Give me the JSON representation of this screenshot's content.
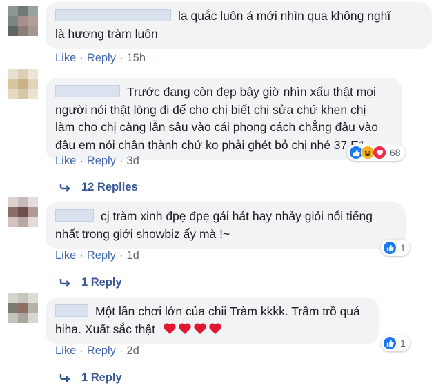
{
  "colors": {
    "bubble": "#f2f3f5",
    "link": "#4267b2",
    "like_blue": "#1877f2",
    "heart_red": "#f0284a",
    "haha_yellow": "#f7b125"
  },
  "comments": [
    {
      "text": "lạ quắc luôn á mới nhìn qua không nghĩ là hương tràm luôn",
      "line1": "lạ quắc luôn á mới nhìn qua không nghĩ",
      "line2": "là hương tràm luôn",
      "like": "Like",
      "reply": "Reply",
      "time": "15h"
    },
    {
      "line1": "Trước đang còn đẹp bây giờ nhìn xấu thật mọi",
      "line2": "người nói thật lòng đi để cho chị biết chị sửa chứ khen chị",
      "line3": "làm cho chị càng lẫn sâu vào cái phong cách chẳng đâu vào",
      "line4": "đâu em nói chân thành chứ ko phải ghét bỏ chị nhé 37 E1",
      "like": "Like",
      "reply": "Reply",
      "time": "3d",
      "reaction_icons": [
        "like-icon",
        "haha-icon",
        "love-icon"
      ],
      "reaction_count": "68",
      "replies_label": "12 Replies"
    },
    {
      "line1": "cj tràm xinh đpẹ đpẹ gái hát hay nhảy giỏi nổi tiếng",
      "line2": "nhất trong giới showbiz ấy mà !~",
      "like": "Like",
      "reply": "Reply",
      "time": "1d",
      "reaction_icons": [
        "like-icon"
      ],
      "reaction_count": "1",
      "replies_label": "1 Reply"
    },
    {
      "line1": "Một lần chơi lớn của chii Tràm kkkk. Trầm trồ quá",
      "line2": "hiha. Xuất sắc thật",
      "emoji": [
        "heart-emoji",
        "heart-emoji",
        "heart-emoji",
        "heart-emoji"
      ],
      "like": "Like",
      "reply": "Reply",
      "time": "2d",
      "reaction_icons": [
        "like-icon"
      ],
      "reaction_count": "1",
      "replies_label": "1 Reply"
    }
  ],
  "separator": "·"
}
